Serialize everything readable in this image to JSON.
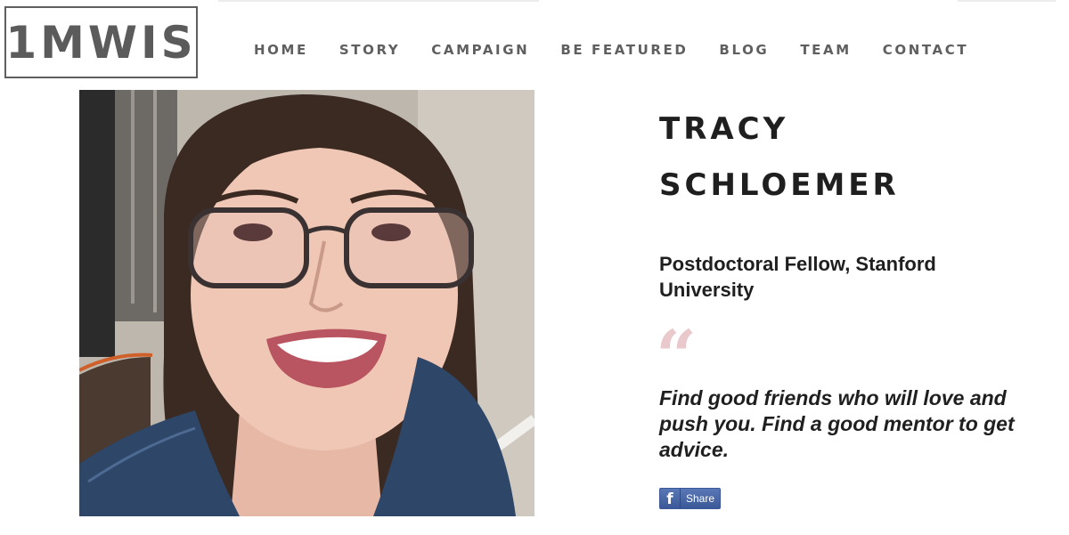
{
  "header": {
    "logo_text": "1MWIS",
    "nav": [
      {
        "label": "HOME"
      },
      {
        "label": "STORY"
      },
      {
        "label": "CAMPAIGN"
      },
      {
        "label": "BE FEATURED"
      },
      {
        "label": "BLOG"
      },
      {
        "label": "TEAM"
      },
      {
        "label": "CONTACT"
      }
    ]
  },
  "profile": {
    "first_name": "TRACY",
    "last_name": "SCHLOEMER",
    "title": "Postdoctoral Fellow, Stanford University",
    "quote_mark": "“",
    "quote": "Find good friends who will love and push you. Find a good mentor to get advice.",
    "share_label": "Share",
    "share_icon": "facebook-icon"
  },
  "colors": {
    "nav_text": "#5f5f5f",
    "heading_text": "#1f1f1f",
    "quote_mark": "#eac9cc",
    "facebook": "#3b5998"
  }
}
